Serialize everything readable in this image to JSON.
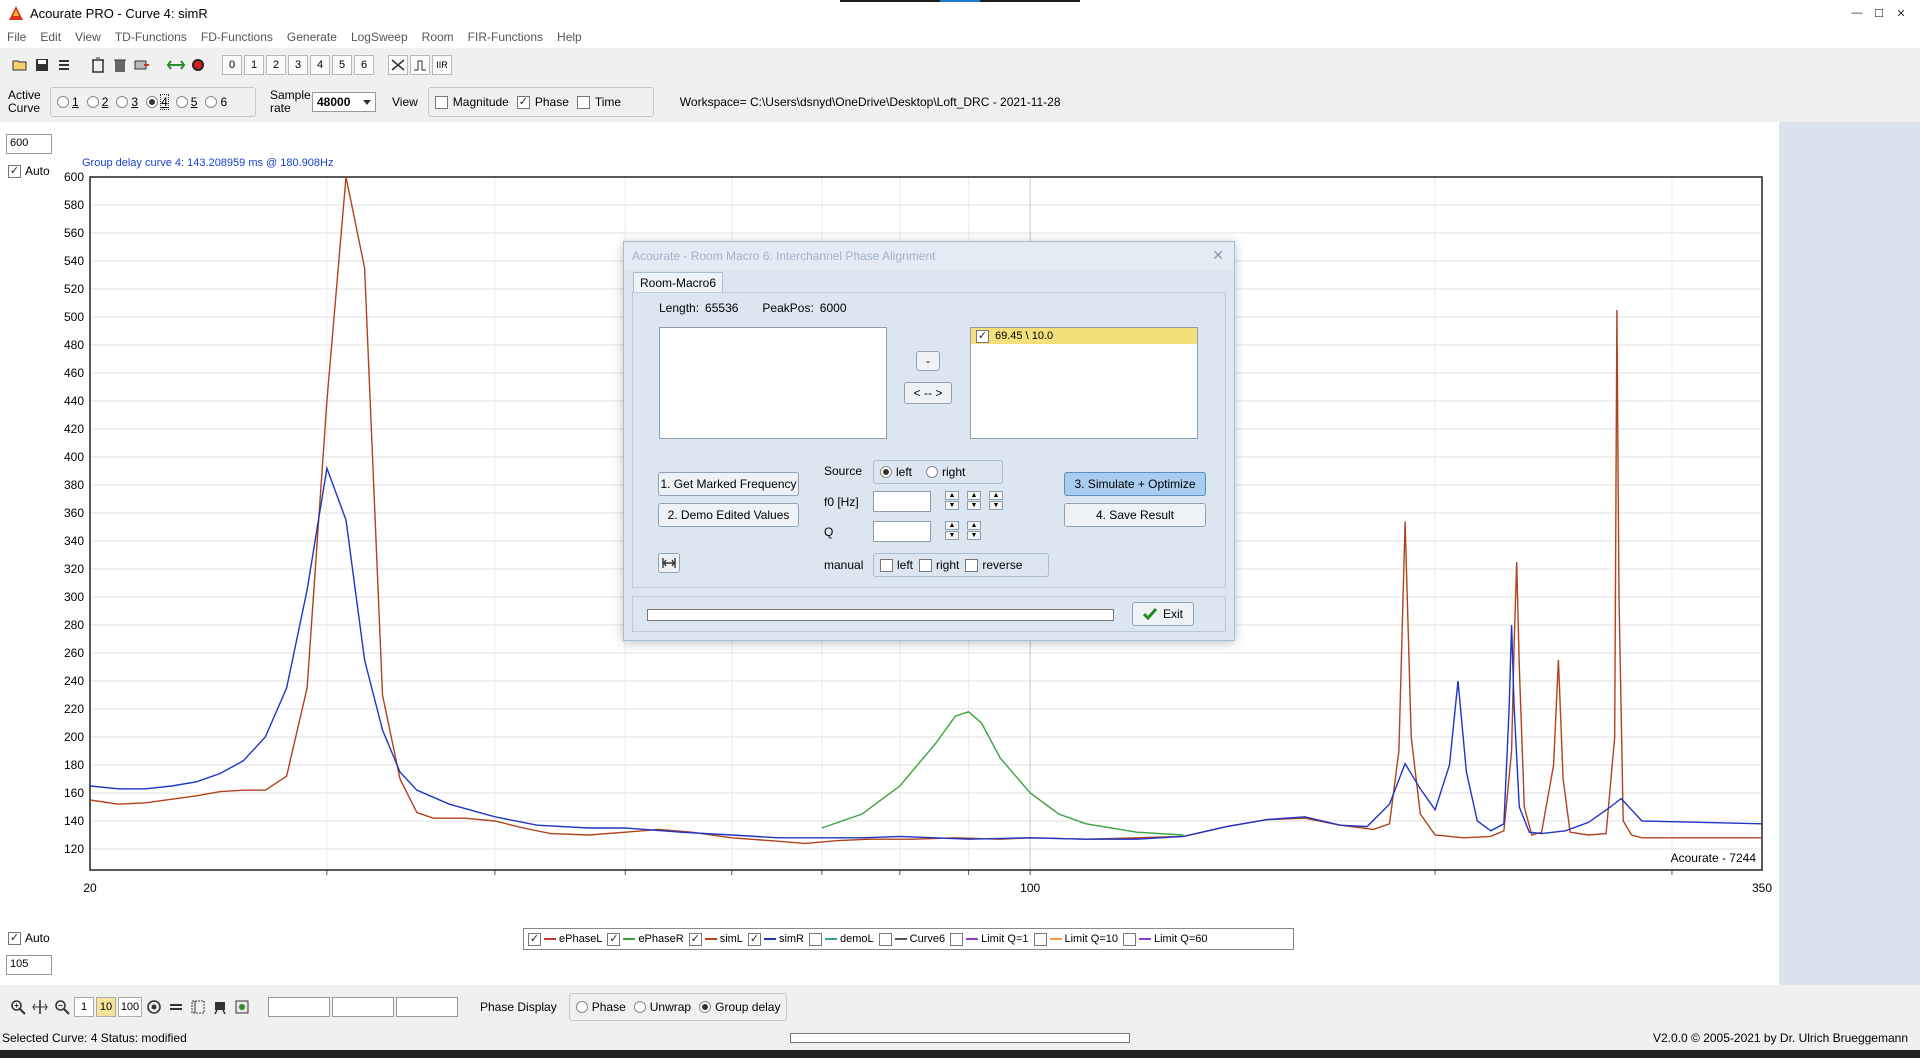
{
  "window": {
    "title": "Acourate PRO - Curve 4: simR",
    "controls": [
      "—",
      "☐",
      "✕"
    ]
  },
  "menu": [
    "File",
    "Edit",
    "View",
    "TD-Functions",
    "FD-Functions",
    "Generate",
    "LogSweep",
    "Room",
    "FIR-Functions",
    "Help"
  ],
  "toolbar": {
    "curve_numbers": [
      "0",
      "1",
      "2",
      "3",
      "4",
      "5",
      "6"
    ],
    "icons": [
      "open-folder-icon",
      "save-icon",
      "settings-icon",
      "delete-all-icon",
      "delete-icon",
      "export-icon",
      "link-icon",
      "record-icon"
    ],
    "tool_icons": [
      "swap-icon",
      "pulse-icon"
    ],
    "iir_label": "IIR"
  },
  "options": {
    "active_curve_label": "Active Curve",
    "curves": [
      "1",
      "2",
      "3",
      "4",
      "5",
      "6"
    ],
    "selected_curve": "4",
    "sample_rate_label": "Sample rate",
    "sample_rate": "48000",
    "view_label": "View",
    "view_magnitude": "Magnitude",
    "view_phase": "Phase",
    "view_time": "Time",
    "workspace": "Workspace= C:\\Users\\dsnyd\\OneDrive\\Desktop\\Loft_DRC - 2021-11-28"
  },
  "chart_controls": {
    "y_max": "600",
    "y_min": "105",
    "auto_label": "Auto",
    "auto_label_bottom": "Auto"
  },
  "chart_data": {
    "type": "line",
    "title": "Group delay curve 4:  143.208959 ms @ 180.908Hz",
    "ylim": [
      105,
      600
    ],
    "xlim": [
      20,
      350
    ],
    "x_scale": "log",
    "yticks": [
      120,
      140,
      160,
      180,
      200,
      220,
      240,
      260,
      280,
      300,
      320,
      340,
      360,
      380,
      400,
      420,
      440,
      460,
      480,
      500,
      520,
      540,
      560,
      580,
      600
    ],
    "xtick_labels": [
      "20",
      "100",
      "350"
    ],
    "watermark": "Acourate - 7244",
    "grid": true,
    "series": [
      {
        "name": "simL",
        "color": "#b0431c",
        "points": [
          [
            20,
            155
          ],
          [
            21,
            152
          ],
          [
            22,
            153
          ],
          [
            24,
            158
          ],
          [
            25,
            161
          ],
          [
            26,
            162
          ],
          [
            27,
            162
          ],
          [
            28,
            172
          ],
          [
            29,
            235
          ],
          [
            30,
            440
          ],
          [
            31,
            600
          ],
          [
            32,
            535
          ],
          [
            33,
            230
          ],
          [
            34,
            170
          ],
          [
            35,
            146
          ],
          [
            36,
            142
          ],
          [
            38,
            142
          ],
          [
            40,
            140
          ],
          [
            42,
            135
          ],
          [
            44,
            131
          ],
          [
            47,
            130
          ],
          [
            50,
            132
          ],
          [
            53,
            134
          ],
          [
            56,
            132
          ],
          [
            60,
            128
          ],
          [
            64,
            126
          ],
          [
            68,
            124
          ],
          [
            72,
            126
          ],
          [
            76,
            127
          ],
          [
            82,
            127
          ],
          [
            88,
            128
          ],
          [
            95,
            127
          ],
          [
            100,
            128
          ],
          [
            110,
            127
          ],
          [
            120,
            128
          ],
          [
            130,
            129
          ],
          [
            140,
            136
          ],
          [
            150,
            141
          ],
          [
            160,
            142
          ],
          [
            170,
            137
          ],
          [
            180,
            134
          ],
          [
            185,
            138
          ],
          [
            188,
            190
          ],
          [
            190,
            354
          ],
          [
            192,
            200
          ],
          [
            195,
            145
          ],
          [
            200,
            130
          ],
          [
            210,
            128
          ],
          [
            220,
            129
          ],
          [
            225,
            133
          ],
          [
            228,
            190
          ],
          [
            229,
            268
          ],
          [
            230,
            325
          ],
          [
            231,
            250
          ],
          [
            233,
            150
          ],
          [
            236,
            130
          ],
          [
            240,
            132
          ],
          [
            245,
            180
          ],
          [
            247,
            255
          ],
          [
            249,
            170
          ],
          [
            252,
            132
          ],
          [
            260,
            130
          ],
          [
            268,
            131
          ],
          [
            272,
            200
          ],
          [
            273,
            505
          ],
          [
            274,
            300
          ],
          [
            276,
            140
          ],
          [
            280,
            130
          ],
          [
            285,
            128
          ],
          [
            350,
            128
          ]
        ]
      },
      {
        "name": "simR",
        "color": "#1f35c4",
        "points": [
          [
            20,
            165
          ],
          [
            21,
            163
          ],
          [
            22,
            163
          ],
          [
            23,
            165
          ],
          [
            24,
            168
          ],
          [
            25,
            174
          ],
          [
            26,
            183
          ],
          [
            27,
            200
          ],
          [
            28,
            235
          ],
          [
            29,
            305
          ],
          [
            30,
            392
          ],
          [
            31,
            355
          ],
          [
            32,
            255
          ],
          [
            33,
            205
          ],
          [
            34,
            175
          ],
          [
            35,
            162
          ],
          [
            37,
            152
          ],
          [
            40,
            143
          ],
          [
            43,
            137
          ],
          [
            47,
            135
          ],
          [
            50,
            135
          ],
          [
            55,
            132
          ],
          [
            60,
            130
          ],
          [
            65,
            128
          ],
          [
            70,
            128
          ],
          [
            75,
            128
          ],
          [
            80,
            129
          ],
          [
            90,
            127
          ],
          [
            100,
            128
          ],
          [
            110,
            127
          ],
          [
            120,
            127
          ],
          [
            130,
            129
          ],
          [
            140,
            136
          ],
          [
            150,
            141
          ],
          [
            160,
            143
          ],
          [
            170,
            137
          ],
          [
            178,
            136
          ],
          [
            185,
            152
          ],
          [
            190,
            181
          ],
          [
            195,
            163
          ],
          [
            200,
            148
          ],
          [
            205,
            180
          ],
          [
            208,
            240
          ],
          [
            211,
            175
          ],
          [
            215,
            140
          ],
          [
            220,
            133
          ],
          [
            225,
            138
          ],
          [
            227,
            220
          ],
          [
            228,
            280
          ],
          [
            229,
            220
          ],
          [
            231,
            150
          ],
          [
            235,
            132
          ],
          [
            240,
            131
          ],
          [
            250,
            133
          ],
          [
            260,
            139
          ],
          [
            270,
            150
          ],
          [
            275,
            156
          ],
          [
            280,
            148
          ],
          [
            285,
            140
          ],
          [
            350,
            138
          ]
        ]
      },
      {
        "name": "ePhaseR",
        "color": "#3aa33a",
        "points": [
          [
            70,
            135
          ],
          [
            75,
            145
          ],
          [
            80,
            165
          ],
          [
            85,
            195
          ],
          [
            88,
            215
          ],
          [
            90,
            218
          ],
          [
            92,
            210
          ],
          [
            95,
            185
          ],
          [
            100,
            160
          ],
          [
            105,
            145
          ],
          [
            110,
            138
          ],
          [
            120,
            132
          ],
          [
            130,
            130
          ]
        ]
      }
    ]
  },
  "legend": [
    {
      "label": "ePhaseL",
      "color": "#c0392b",
      "checked": true
    },
    {
      "label": "ePhaseR",
      "color": "#3aa33a",
      "checked": true
    },
    {
      "label": "simL",
      "color": "#b0431c",
      "checked": true
    },
    {
      "label": "simR",
      "color": "#1f35c4",
      "checked": true
    },
    {
      "label": "demoL",
      "color": "#3a9e9e",
      "checked": false
    },
    {
      "label": "Curve6",
      "color": "#555555",
      "checked": false
    },
    {
      "label": "Limit Q=1",
      "color": "#8a3fd1",
      "checked": false
    },
    {
      "label": "Limit Q=10",
      "color": "#f0a040",
      "checked": false
    },
    {
      "label": "Limit Q=60",
      "color": "#8a3fd1",
      "checked": false
    }
  ],
  "bottom_toolbar": {
    "zoom_levels": [
      "1",
      "10",
      "100"
    ],
    "phase_display_label": "Phase Display",
    "phase_options": [
      "Phase",
      "Unwrap",
      "Group delay"
    ],
    "selected_phase": "Group delay"
  },
  "status": {
    "left": "Selected Curve: 4   Status: modified",
    "right": "V2.0.0 © 2005-2021 by Dr. Ulrich Brueggemann"
  },
  "dialog": {
    "title": "Acourate - Room Macro 6: Interchannel Phase Alignment",
    "tab": "Room-Macro6",
    "length_label": "Length:",
    "length_value": "65536",
    "peakpos_label": "PeakPos:",
    "peakpos_value": "6000",
    "list_right_item": "69.45 \\ 10.0",
    "minus_btn": "-",
    "swap_btn": "< -- >",
    "btn1": "1. Get Marked Frequency",
    "btn2": "2. Demo Edited Values",
    "btn3": "3. Simulate + Optimize",
    "btn4": "4. Save Result",
    "source_label": "Source",
    "source_left": "left",
    "source_right": "right",
    "f0_label": "f0 [Hz]",
    "q_label": "Q",
    "manual_label": "manual",
    "manual_left": "left",
    "manual_right": "right",
    "manual_reverse": "reverse",
    "exit_btn": "Exit"
  }
}
